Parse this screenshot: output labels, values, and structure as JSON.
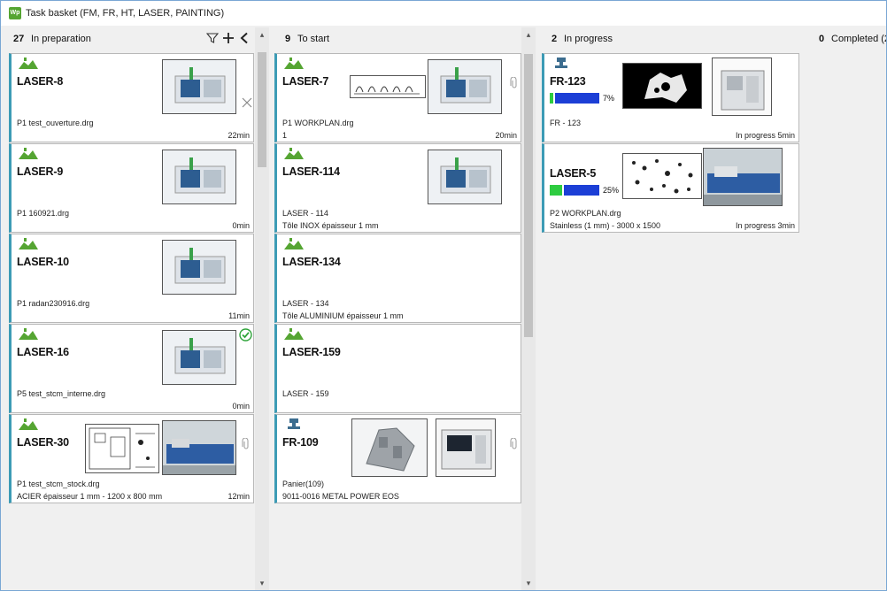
{
  "window": {
    "title": "Task basket (FM, FR, HT, LASER, PAINTING)",
    "app_icon_text": "Wp"
  },
  "columns": [
    {
      "count": "27",
      "label": "In preparation"
    },
    {
      "count": "9",
      "label": "To start"
    },
    {
      "count": "2",
      "label": "In progress"
    },
    {
      "count": "0",
      "label": "Completed (2"
    }
  ],
  "icons": {
    "filter": "filter-icon",
    "add": "plus-icon",
    "collapse": "chevron-left-icon",
    "scroll_up": "▴",
    "scroll_down": "▾"
  },
  "colors": {
    "accent": "#3c9bb5",
    "progress_blue": "#1c3fd6",
    "progress_green": "#2ecc40",
    "laser_icon": "#55a532"
  },
  "prep": [
    {
      "name": "LASER-8",
      "l1": "P1 test_ouverture.drg",
      "l2": "",
      "time": "22min",
      "side": "close-icon"
    },
    {
      "name": "LASER-9",
      "l1": "P1 160921.drg",
      "l2": "",
      "time": "0min",
      "side": ""
    },
    {
      "name": "LASER-10",
      "l1": "P1 radan230916.drg",
      "l2": "",
      "time": "11min",
      "side": ""
    },
    {
      "name": "LASER-16",
      "l1": "P5 test_stcm_interne.drg",
      "l2": "",
      "time": "0min",
      "side": "check-icon"
    },
    {
      "name": "LASER-30",
      "l1": "P1 test_stcm_stock.drg",
      "l2": "ACIER épaisseur 1 mm - 1200 x 800 mm",
      "time": "12min",
      "side": "paperclip-icon"
    }
  ],
  "start": [
    {
      "name": "LASER-7",
      "l1": "P1 WORKPLAN.drg",
      "l2": "1",
      "time": "20min"
    },
    {
      "name": "LASER-114",
      "l1": "LASER - 114",
      "l2": "Tôle INOX épaisseur 1 mm",
      "time": ""
    },
    {
      "name": "LASER-134",
      "l1": "LASER - 134",
      "l2": "Tôle ALUMINIUM épaisseur 1 mm",
      "time": ""
    },
    {
      "name": "LASER-159",
      "l1": "LASER - 159",
      "l2": "",
      "time": ""
    },
    {
      "name": "FR-109",
      "l1": "Panier(109)",
      "l2": "9011-0016 METAL POWER EOS",
      "time": ""
    }
  ],
  "progress": [
    {
      "name": "FR-123",
      "pct_label": "7%",
      "pct": 0.07,
      "l1": "FR - 123",
      "l2": "",
      "time": "In progress 5min"
    },
    {
      "name": "LASER-5",
      "pct_label": "25%",
      "pct": 0.25,
      "l1": "P2 WORKPLAN.drg",
      "l2": "Stainless (1 mm) - 3000 x 1500",
      "time": "In progress 3min"
    }
  ]
}
